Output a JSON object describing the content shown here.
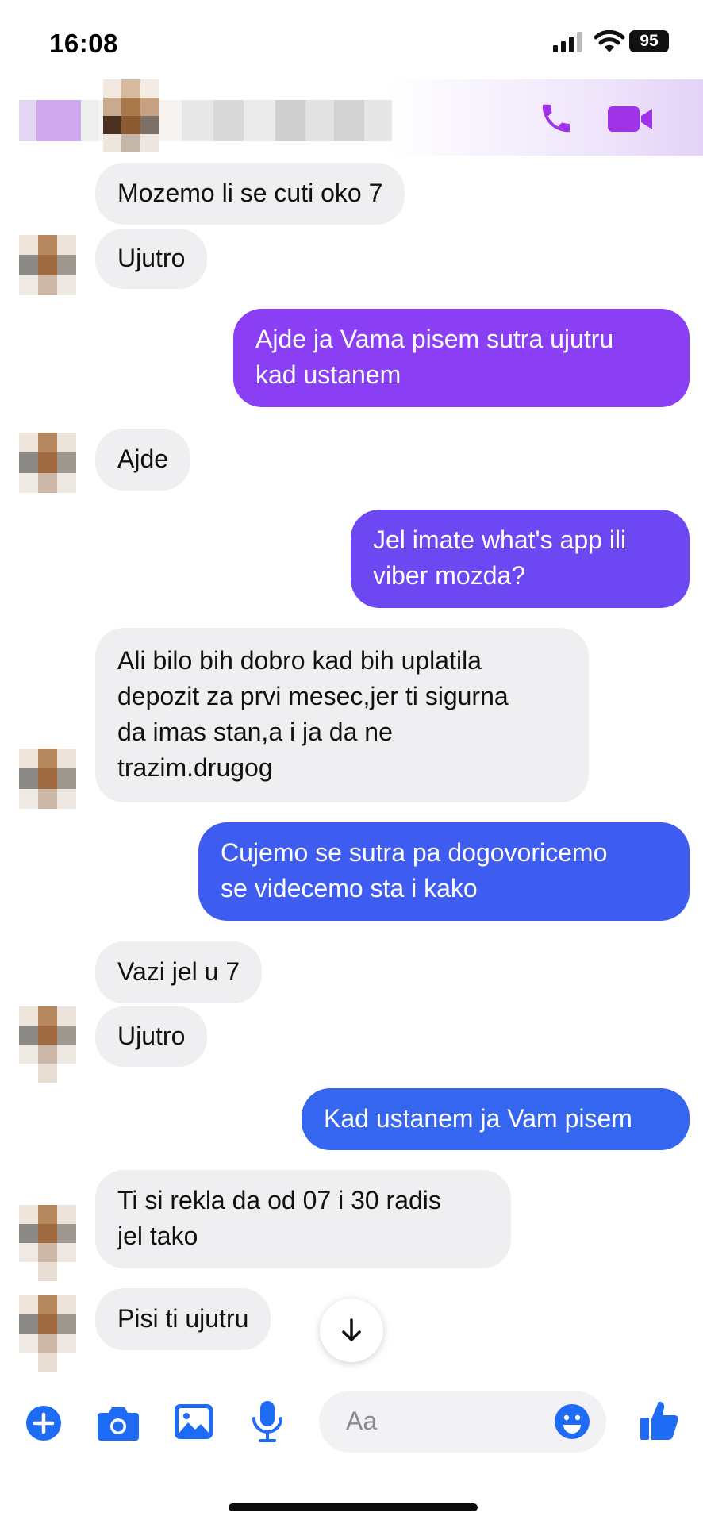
{
  "status_bar": {
    "time": "16:08",
    "battery": "95"
  },
  "header": {
    "contact_name": "",
    "call_icon": "phone-icon",
    "video_icon": "video-camera-icon"
  },
  "colors": {
    "accent_blue": "#1e6bf5",
    "bubble_purple": "#8a3ff5",
    "bubble_violet": "#6d47f2",
    "bubble_blue": "#3466f0",
    "incoming_bg": "#efeff2"
  },
  "messages": [
    {
      "dir": "in",
      "text": "Mozemo li se cuti oko 7"
    },
    {
      "dir": "in",
      "text": "Ujutro"
    },
    {
      "dir": "out",
      "text": "Ajde ja Vama pisem sutra ujutru\nkad ustanem"
    },
    {
      "dir": "in",
      "text": "Ajde"
    },
    {
      "dir": "out",
      "text": "Jel imate what's app ili\nviber mozda?"
    },
    {
      "dir": "in",
      "text": "Ali bilo bih dobro kad bih uplatila\ndepozit za prvi mesec,jer ti sigurna\nda imas stan,a i ja da ne\ntrazim.drugog"
    },
    {
      "dir": "out",
      "text": "Cujemo se sutra pa dogovoricemo\nse videcemo sta i kako"
    },
    {
      "dir": "in",
      "text": "Vazi jel u 7"
    },
    {
      "dir": "in",
      "text": "Ujutro"
    },
    {
      "dir": "out",
      "text": "Kad ustanem ja Vam pisem"
    },
    {
      "dir": "in",
      "text": "Ti si rekla da od 07 i 30 radis\njel tako"
    },
    {
      "dir": "in",
      "text": "Pisi ti ujutru"
    }
  ],
  "composer": {
    "placeholder": "Aa",
    "icons": [
      "plus-icon",
      "camera-icon",
      "image-icon",
      "microphone-icon",
      "emoji-icon",
      "thumbs-up-icon"
    ]
  }
}
